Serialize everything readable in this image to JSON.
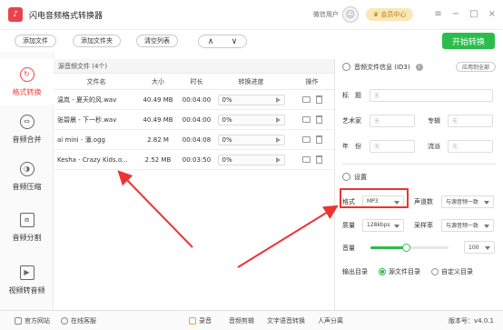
{
  "app": {
    "title": "闪电音频格式转换器",
    "logo_icon": "music-note-icon"
  },
  "titlebar": {
    "user_name": "微信用户",
    "vip_label": "会员中心"
  },
  "toolbar": {
    "add_file": "添加文件",
    "add_folder": "添加文件夹",
    "clear_list": "清空列表",
    "up": "∧",
    "down": "∨",
    "start": "开始转换"
  },
  "sidebar": {
    "items": [
      {
        "label": "格式转换",
        "icon": "refresh-icon"
      },
      {
        "label": "音频合并",
        "icon": "merge-icon"
      },
      {
        "label": "音频压缩",
        "icon": "compress-icon"
      },
      {
        "label": "音频分割",
        "icon": "split-icon"
      },
      {
        "label": "视频转音频",
        "icon": "video-icon"
      }
    ]
  },
  "file_panel": {
    "header": "源音频文件 (4个)",
    "columns": {
      "name": "文件名",
      "size": "大小",
      "duration": "时长",
      "progress": "转换进度",
      "ops": "操作"
    },
    "rows": [
      {
        "name": "温岚 - 夏天的风.wav",
        "size": "40.49 MB",
        "duration": "00:04:00",
        "progress": "0%"
      },
      {
        "name": "张碧晨 - 下一秒.wav",
        "size": "40.49 MB",
        "duration": "00:04:00",
        "progress": "0%"
      },
      {
        "name": "ai mini - 潘.ogg",
        "size": "2.82 M",
        "duration": "00:04:08",
        "progress": "0%"
      },
      {
        "name": "Kesha - Crazy Kids.o...",
        "size": "2.52 MB",
        "duration": "00:03:50",
        "progress": "0%"
      }
    ]
  },
  "id3": {
    "title": "音频文件信息 (ID3)",
    "info": "i",
    "apply_all": "应用到全部",
    "fields": {
      "title_label": "标　题",
      "artist_label": "艺术家",
      "album_label": "专辑",
      "year_label": "年　份",
      "genre_label": "流派",
      "placeholder": "无"
    }
  },
  "settings": {
    "title": "设置",
    "format_label": "格式",
    "format_value": "MP3",
    "channel_label": "声道数",
    "channel_value": "与源音频一致",
    "quality_label": "质量",
    "quality_value": "128kbps",
    "samplerate_label": "采样率",
    "samplerate_value": "与源音频一致",
    "volume_label": "音量",
    "volume_value": "100",
    "volume_level": 0.45,
    "output_label": "输出目录",
    "output_source": "源文件目录",
    "output_custom": "自定义目录"
  },
  "footer": {
    "website": "官方网站",
    "support": "在线客服",
    "record": "录音",
    "edit": "音频剪辑",
    "tts": "文字语音转换",
    "vocal": "人声分离",
    "version": "版本号：v4.0.1"
  },
  "colors": {
    "accent": "#2bbd4b",
    "active": "#e44444",
    "annotation": "#e33333"
  }
}
